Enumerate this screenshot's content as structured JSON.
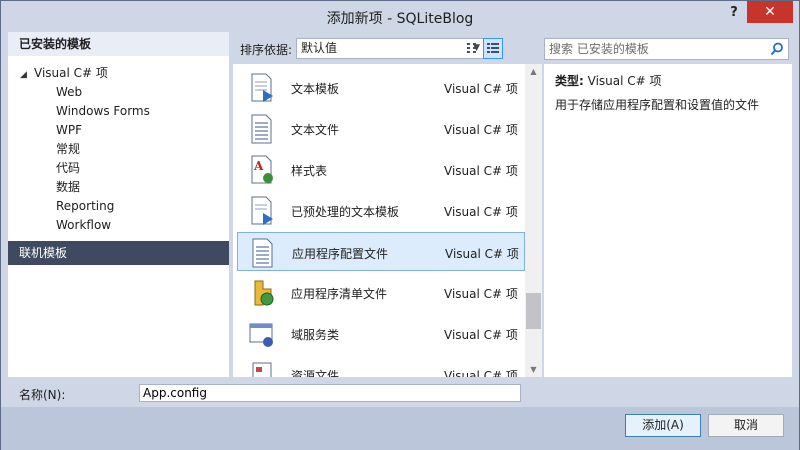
{
  "window": {
    "title": "添加新项 - SQLiteBlog",
    "help_label": "?",
    "close_label": "✕"
  },
  "left": {
    "header": "已安装的模板",
    "root": "Visual C# 项",
    "children": [
      "Web",
      "Windows Forms",
      "WPF",
      "常规",
      "代码",
      "数据",
      "Reporting",
      "Workflow"
    ],
    "online": "联机模板"
  },
  "toolbar": {
    "sort_label": "排序依据:",
    "sort_value": "默认值"
  },
  "search": {
    "placeholder": "搜索 已安装的模板"
  },
  "items": [
    {
      "name": "文本模板",
      "type": "Visual C# 项",
      "icon": "text-template-icon"
    },
    {
      "name": "文本文件",
      "type": "Visual C# 项",
      "icon": "text-file-icon"
    },
    {
      "name": "样式表",
      "type": "Visual C# 项",
      "icon": "stylesheet-icon"
    },
    {
      "name": "已预处理的文本模板",
      "type": "Visual C# 项",
      "icon": "preprocessed-template-icon"
    },
    {
      "name": "应用程序配置文件",
      "type": "Visual C# 项",
      "icon": "config-file-icon",
      "selected": true
    },
    {
      "name": "应用程序清单文件",
      "type": "Visual C# 项",
      "icon": "manifest-file-icon"
    },
    {
      "name": "域服务类",
      "type": "Visual C# 项",
      "icon": "domain-service-icon"
    },
    {
      "name": "资源文件",
      "type": "Visual C# 项",
      "icon": "resource-file-icon"
    }
  ],
  "detail": {
    "type_label": "类型:",
    "type_value": "Visual C# 项",
    "description": "用于存储应用程序配置和设置值的文件"
  },
  "bottom": {
    "name_label": "名称(N):",
    "name_value": "App.config",
    "add_label": "添加(A)",
    "cancel_label": "取消"
  },
  "colors": {
    "selection": "#dcecfc",
    "online_bg": "#3f4a60",
    "close_bg": "#c7342b"
  }
}
